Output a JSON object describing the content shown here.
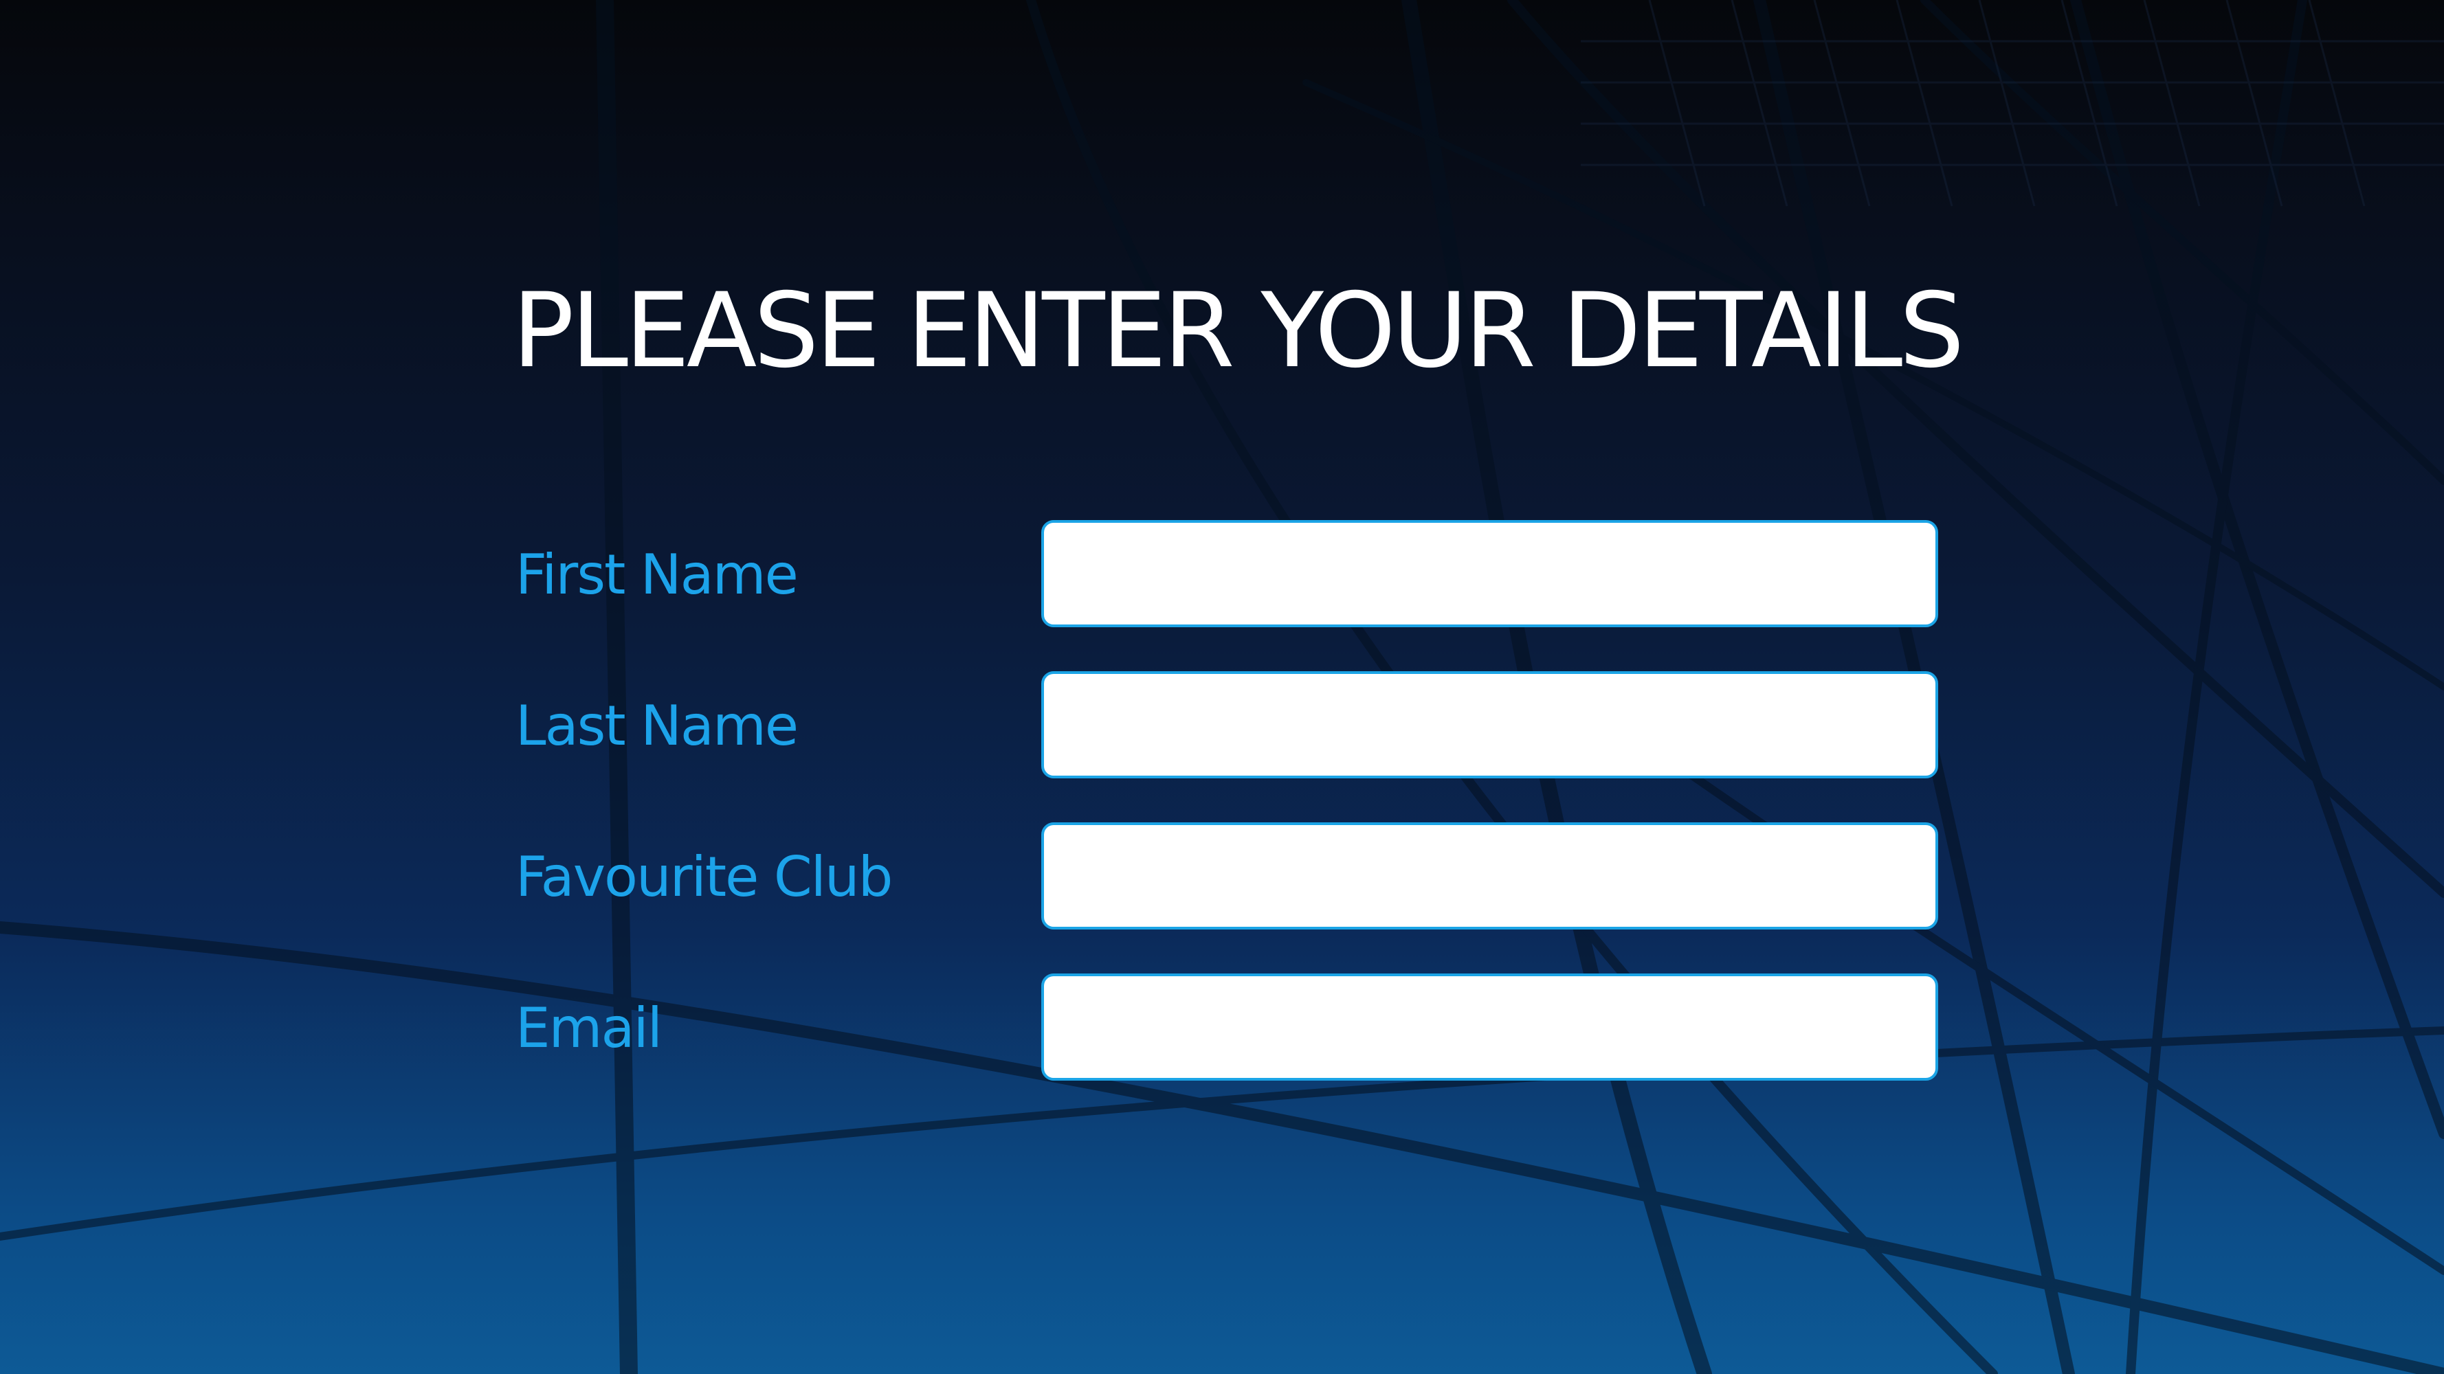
{
  "form": {
    "title": "PLEASE ENTER YOUR DETAILS",
    "fields": [
      {
        "label": "First Name",
        "value": "",
        "placeholder": ""
      },
      {
        "label": "Last Name",
        "value": "",
        "placeholder": ""
      },
      {
        "label": "Favourite Club",
        "value": "",
        "placeholder": ""
      },
      {
        "label": "Email",
        "value": "",
        "placeholder": ""
      }
    ]
  },
  "theme": {
    "label_color": "#1ca3ea",
    "input_border_color": "#1ba4e6",
    "title_color": "#ffffff",
    "background_top": "#05070b",
    "background_bottom": "#0d5a96"
  }
}
